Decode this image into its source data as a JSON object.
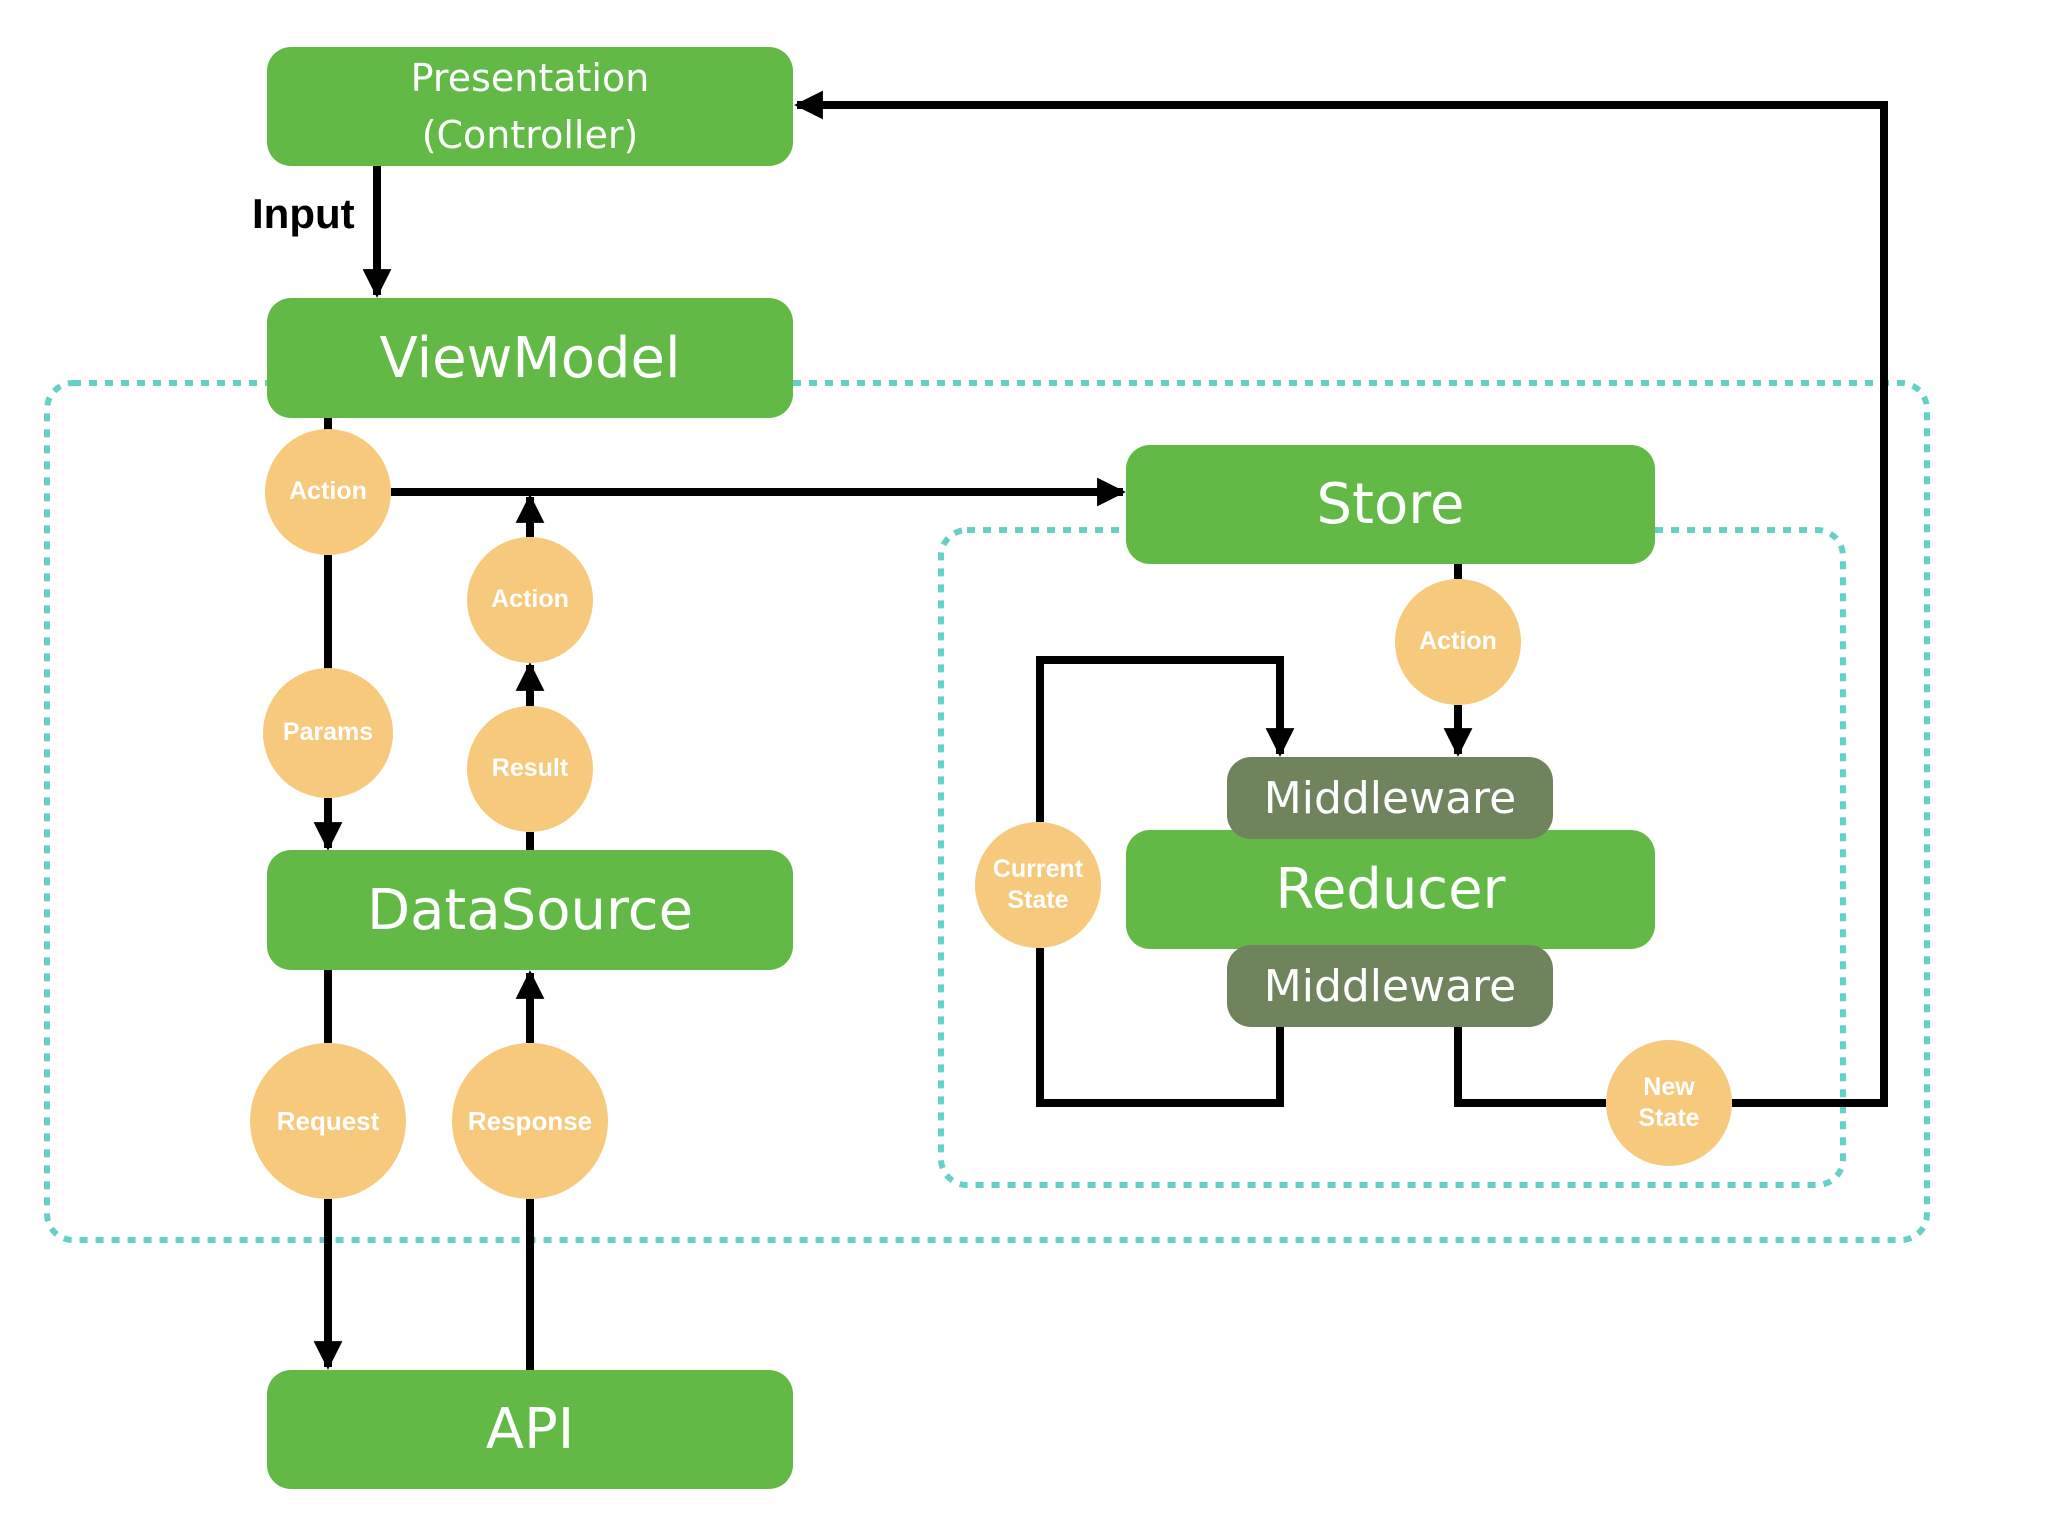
{
  "diagram": {
    "colors": {
      "component": "#62B946",
      "middleware": "#6F845D",
      "message": "#F6C97C",
      "boundary": "#66CFC6",
      "arrow": "#000000"
    },
    "components": {
      "presentation": {
        "line1": "Presentation",
        "line2": "(Controller)"
      },
      "viewmodel": "ViewModel",
      "store": "Store",
      "datasource": "DataSource",
      "api": "API",
      "middleware_top": "Middleware",
      "reducer": "Reducer",
      "middleware_bottom": "Middleware"
    },
    "edge_labels": {
      "input": "Input"
    },
    "messages": {
      "action_vm": "Action",
      "action_result": "Action",
      "params": "Params",
      "result": "Result",
      "request": "Request",
      "response": "Response",
      "action_store": "Action",
      "current_state": {
        "line1": "Current",
        "line2": "State"
      },
      "new_state": {
        "line1": "New",
        "line2": "State"
      }
    },
    "edges": [
      {
        "from": "Presentation",
        "to": "ViewModel",
        "label": "Input"
      },
      {
        "from": "ViewModel",
        "to": "Store",
        "via": "Action"
      },
      {
        "from": "ViewModel",
        "to": "DataSource",
        "via": "Params"
      },
      {
        "from": "DataSource",
        "to": "ViewModel",
        "via": [
          "Result",
          "Action"
        ]
      },
      {
        "from": "DataSource",
        "to": "API",
        "via": "Request"
      },
      {
        "from": "API",
        "to": "DataSource",
        "via": "Response"
      },
      {
        "from": "Store",
        "to": "Middleware",
        "via": "Action"
      },
      {
        "from": "Middleware",
        "to": "Middleware",
        "via": "Current State"
      },
      {
        "from": "Middleware",
        "to": "Presentation",
        "via": "New State"
      }
    ]
  }
}
